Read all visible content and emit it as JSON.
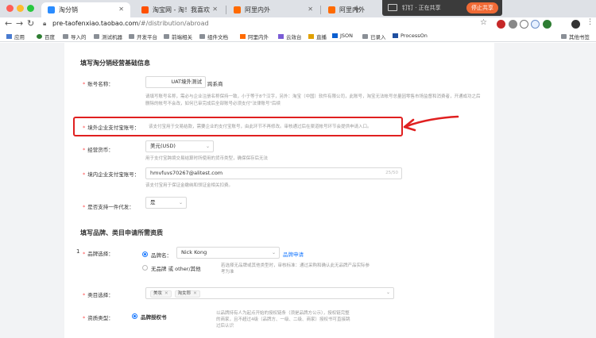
{
  "browser": {
    "tabs": [
      {
        "title": "淘分销",
        "active": true,
        "favicon_color": "#2a8cff"
      },
      {
        "title": "淘宝网 - 淘！我喜欢",
        "active": false,
        "favicon_color": "#ff5000"
      },
      {
        "title": "阿里内外",
        "active": false,
        "favicon_color": "#ff6a00"
      },
      {
        "title": "阿里内外",
        "active": false,
        "favicon_color": "#ff6a00"
      }
    ],
    "new_tab_label": "+",
    "url_host": "pre-taofenxiao.taobao.com",
    "url_path": "/#/distribution/abroad",
    "bookmarks": [
      {
        "label": "应用",
        "icon": "apps-icon"
      },
      {
        "label": "百度",
        "icon": "baidu-icon"
      },
      {
        "label": "导入的",
        "icon": "folder-icon"
      },
      {
        "label": "测试机器",
        "icon": "folder-icon"
      },
      {
        "label": "开发平台",
        "icon": "folder-icon"
      },
      {
        "label": "前端相关",
        "icon": "folder-icon"
      },
      {
        "label": "组件文档",
        "icon": "folder-icon"
      },
      {
        "label": "阿里内外",
        "icon": "alibaba-icon"
      },
      {
        "label": "云效台",
        "icon": "cloud-icon"
      },
      {
        "label": "直播",
        "icon": "live-icon"
      },
      {
        "label": "JSON",
        "icon": "json-icon"
      },
      {
        "label": "已录入",
        "icon": "folder-icon"
      },
      {
        "label": "ProcessOn",
        "icon": "processon-icon"
      }
    ],
    "other_bookmarks": "其他书签",
    "meeting_bar": {
      "text": "钉钉 · 正在共享",
      "stop_label": "停止共享"
    }
  },
  "form": {
    "section1_title": "填写淘分销经营基础信息",
    "account_name": {
      "label": "账号名称：",
      "value": "UAT境外测试",
      "suffix": "跨系商",
      "hint": "请填写账号名称，需必与企业注册名称保持一致，小于等于8个汉字，另外：淘宝（中国）软件有限公司，此账号，淘宝无法帐号总量因零售市场监督和消费者，开通成功之后删除的帐号不会改，如何已审完成后全部账号必须支付\"法律账号\"后续"
    },
    "overseas_alipay": {
      "label": "境外企业支付宝账号：",
      "hint": "该支付宝用于交易结款，需要企业的支付宝账号，由此环节不再修改。审核通过后在渠道帐号环节会提供申请入口。"
    },
    "currency": {
      "label": "经营货币：",
      "value": "美元(USD)",
      "hint": "用于支付宝跨境交易结算时所使用的货币类型，确保保存后无法"
    },
    "domestic_alipay": {
      "label": "境内企业支付宝账号：",
      "value": "hmvfuvs70267@alitest.com",
      "count": "25/50",
      "hint": "该支付宝用于保证金缴纳和领证金相关扣费。"
    },
    "support_one_piece": {
      "label": "是否支持一件代发：",
      "value": "是"
    },
    "section2_title": "填写品牌、类目申请所需资质",
    "brand_select": {
      "label": "品牌选择：",
      "option1": "品牌名：",
      "brand_value": "Nick Kong",
      "apply_link": "品牌申请",
      "option2": "无品牌 或 other/其他",
      "option2_hint": "若选择无品牌或其他类型时，审核标准：通过采购和确认此无品牌产品实际参考为准"
    },
    "category_select": {
      "label": "类目选择：",
      "tags": [
        "美妆",
        "淘女郎"
      ]
    },
    "qualification_type": {
      "label": "资质类型：",
      "option": "品牌授权书",
      "hint": "以品牌持有人为起点开始的授权链条（须是品牌方公示），授权链完整的商家，且不超过4级（品牌方、一级、二级、商家）授权书可直接跳过后认识"
    },
    "margin_marker": "1"
  }
}
